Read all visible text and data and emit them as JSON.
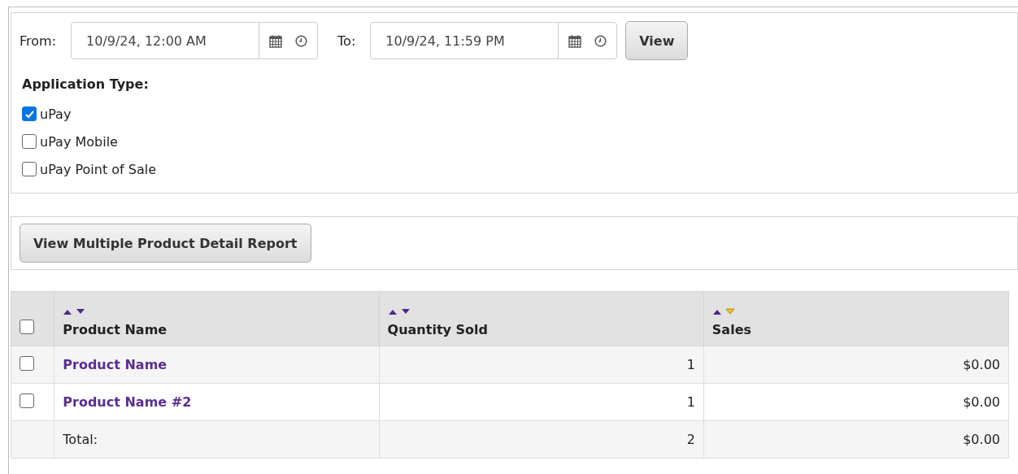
{
  "filters": {
    "from_label": "From:",
    "from_value": "10/9/24, 12:00 AM",
    "to_label": "To:",
    "to_value": "10/9/24, 11:59 PM",
    "view_button": "View"
  },
  "application_type": {
    "label": "Application Type:",
    "options": [
      {
        "label": "uPay",
        "checked": true
      },
      {
        "label": "uPay Mobile",
        "checked": false
      },
      {
        "label": "uPay Point of Sale",
        "checked": false
      }
    ]
  },
  "report_button": "View Multiple Product Detail Report",
  "table": {
    "select_all_checked": false,
    "columns": [
      {
        "label": "Product Name",
        "sorted_desc": false
      },
      {
        "label": "Quantity Sold",
        "sorted_desc": false
      },
      {
        "label": "Sales",
        "sorted_desc": true
      }
    ],
    "rows": [
      {
        "checked": false,
        "cells": [
          "Product Name",
          "1",
          "$0.00"
        ]
      },
      {
        "checked": false,
        "cells": [
          "Product Name #2",
          "1",
          "$0.00"
        ]
      }
    ],
    "total": {
      "cells": [
        "Total:",
        "2",
        "$0.00"
      ]
    }
  }
}
